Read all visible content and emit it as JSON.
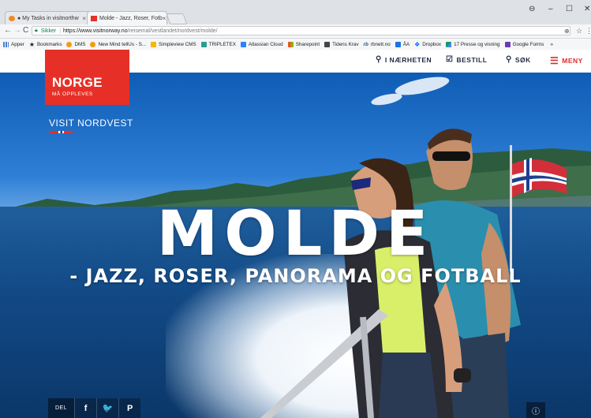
{
  "browser": {
    "tabs": [
      {
        "title": "● My Tasks in visitnorthw"
      },
      {
        "title": "Molde - Jazz, Roser, Fotb"
      }
    ],
    "url_secure_label": "Sikker",
    "url_host": "https://www.visitnorway.no",
    "url_path": "/reisemal/vestlandet/nordvest/molde/",
    "bookmarks": [
      "Apper",
      "Bookmarks",
      "DMS",
      "New Mind tellUs - S...",
      "Simpleview CMS",
      "TRIPLETEX",
      "Atlassian Cloud",
      "Sharepoint",
      "Tidens Krav",
      "rbnett.no",
      "ÅA",
      "Dropbox",
      "17 Presse og visning",
      "Google Forms"
    ],
    "bookmark_overflow": "»",
    "window_controls": [
      "⊖",
      "–",
      "☐",
      "✕"
    ]
  },
  "site": {
    "logo_main": "NORGE",
    "logo_sub": "MÅ OPPLEVES",
    "region": "VISIT NORDVEST",
    "nav": {
      "nearby": "I NÆRHETEN",
      "order": "BESTILL",
      "search": "SØK",
      "menu": "MENY"
    },
    "hero": {
      "title": "MOLDE",
      "subtitle": "- JAZZ, ROSER, PANORAMA OG FOTBALL"
    },
    "share": {
      "label": "DEL",
      "facebook": "f",
      "twitter": "🐦",
      "pinterest": "P"
    },
    "info": "ⓘ"
  },
  "colors": {
    "brand_red": "#e63027",
    "nav_dark": "#1f2a44",
    "menu_red": "#d72e2e"
  }
}
